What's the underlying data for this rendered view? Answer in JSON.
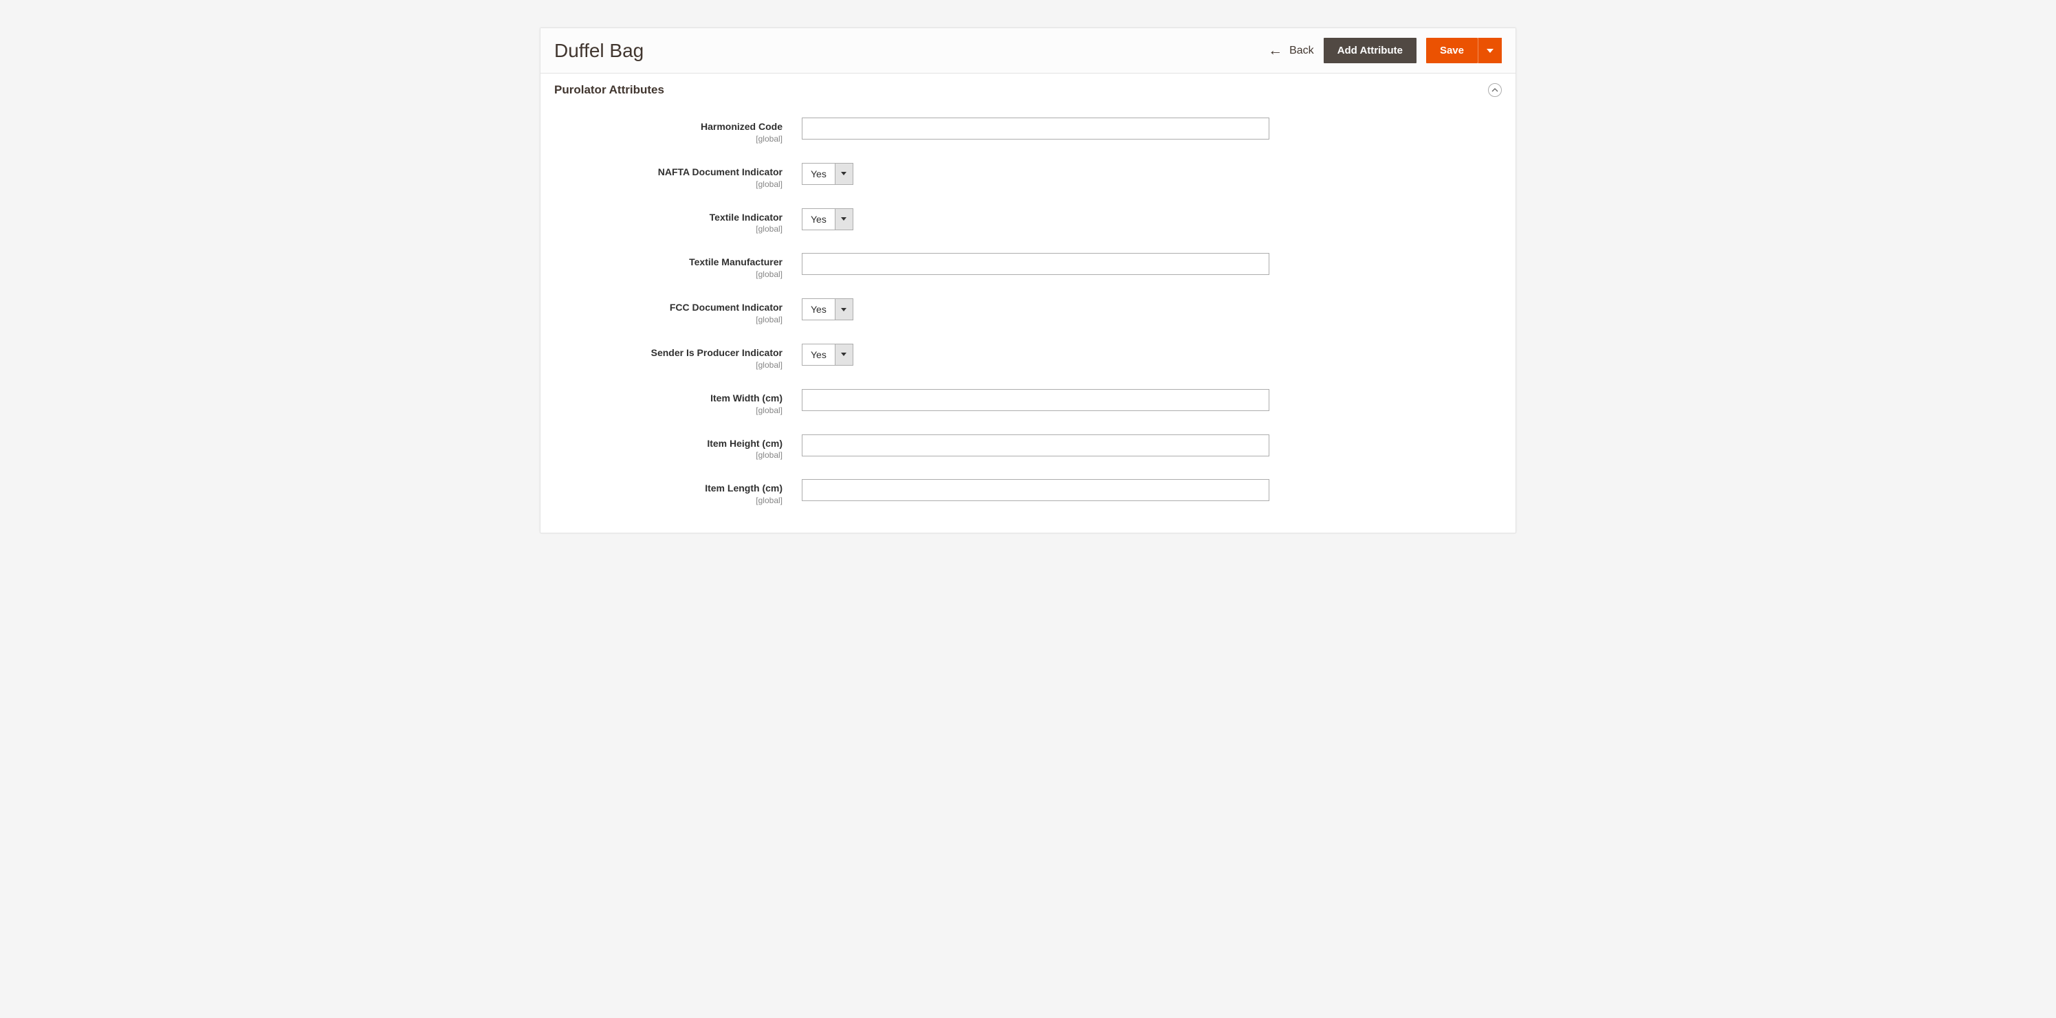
{
  "header": {
    "title": "Duffel Bag",
    "back_label": "Back",
    "add_attribute_label": "Add Attribute",
    "save_label": "Save"
  },
  "section": {
    "title": "Purolator Attributes",
    "scope_label": "[global]",
    "fields": {
      "harmonized_code": {
        "label": "Harmonized Code",
        "value": ""
      },
      "nafta_document_indicator": {
        "label": "NAFTA Document Indicator",
        "value": "Yes"
      },
      "textile_indicator": {
        "label": "Textile Indicator",
        "value": "Yes"
      },
      "textile_manufacturer": {
        "label": "Textile Manufacturer",
        "value": ""
      },
      "fcc_document_indicator": {
        "label": "FCC Document Indicator",
        "value": "Yes"
      },
      "sender_is_producer_indicator": {
        "label": "Sender Is Producer Indicator",
        "value": "Yes"
      },
      "item_width": {
        "label": "Item Width (cm)",
        "value": ""
      },
      "item_height": {
        "label": "Item Height (cm)",
        "value": ""
      },
      "item_length": {
        "label": "Item Length (cm)",
        "value": ""
      }
    }
  }
}
